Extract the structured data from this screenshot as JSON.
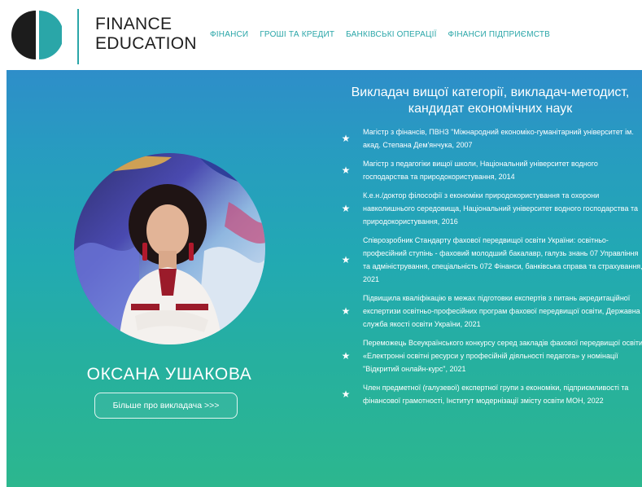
{
  "header": {
    "logo_line1": "FINANCE",
    "logo_line2": "EDUCATION",
    "nav": [
      "ФІНАНСИ",
      "ГРОШІ ТА КРЕДИТ",
      "БАНКІВСЬКІ ОПЕРАЦІЇ",
      "ФІНАНСИ ПІДПРИЄМСТВ"
    ]
  },
  "hero": {
    "title": "Викладач вищої категорії, викладач-методист, кандидат економічних наук",
    "name": "ОКСАНА УШАКОВА",
    "more_button": "Більше про викладача >>>",
    "items": [
      "Магістр з фінансів, ПВНЗ \"Міжнародний економіко-гуманітарний університет ім. акад. Степана Дем'янчука, 2007",
      "Магістр з педагогіки вищої школи, Національний університет водного господарства та природокористування, 2014",
      "К.е.н./доктор філософії з економіки природокористування та охорони навколишнього середовища, Національний університет водного господарства та природокористування, 2016",
      "Співрозробник Стандарту фахової передвищої освіти України: освітньо-професійний ступінь - фаховий молодший бакалавр, галузь знань 07 Управління та адміністрування, спеціальність 072 Фінанси, банківська справа та страхування, 2021",
      "Підвищила кваліфікацію в межах підготовки експертів з питань акредитаційної експертизи освітньо-професійних програм фахової передвищої освіти, Державна служба якості освіти України, 2021",
      "Переможець Всеукраїнського конкурсу серед закладів фахової передвищої освіти «Електронні освітні ресурси у професійній діяльності педагога» у номінації \"Відкритий онлайн-курс\", 2021",
      "Член предметної (галузевої) експертної групи з економіки, підприємливості та фінансової грамотності, Інститут модернізації змісту освіти МОН, 2022"
    ]
  },
  "colors": {
    "accent": "#2aa6a8",
    "gradient_top": "#2e8ec9",
    "gradient_bottom": "#2cb78e",
    "logo_dark": "#1c1c1c"
  },
  "icons": [
    "logo-mark",
    "star-icon"
  ]
}
